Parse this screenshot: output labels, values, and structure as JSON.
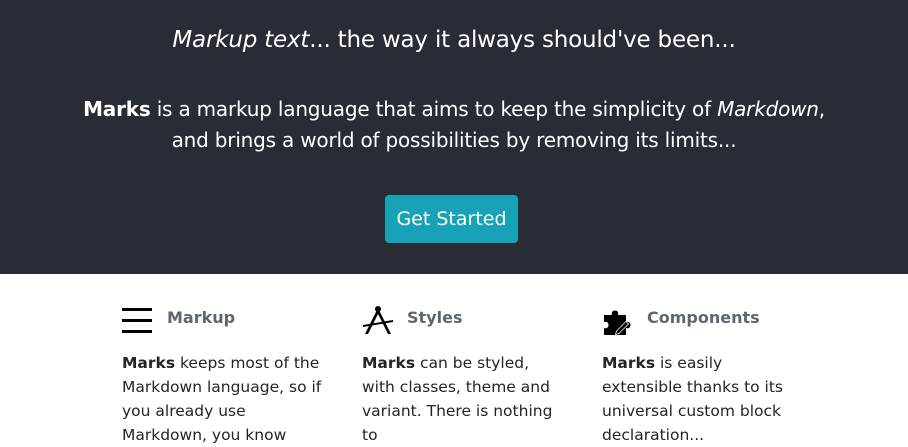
{
  "hero": {
    "tagline_em": "Markup text",
    "tagline_rest": "... the way it always should've been...",
    "intro_brand": "Marks",
    "intro_part1": " is a markup language that aims to keep the simplicity of ",
    "intro_em": "Markdown",
    "intro_part2": ",",
    "intro_line2": "and brings a world of possibilities by removing its limits...",
    "cta_label": "Get Started"
  },
  "features": [
    {
      "icon": "hamburger-menu-icon",
      "title": "Markup",
      "brand": "Marks",
      "text": " keeps most of the Markdown language, so if you already use Markdown, you know"
    },
    {
      "icon": "drafting-compass-icon",
      "title": "Styles",
      "brand": "Marks",
      "text": " can be styled, with classes, theme and variant. There is nothing to"
    },
    {
      "icon": "puzzle-piece-icon",
      "title": "Components",
      "brand": "Marks",
      "text": " is easily extensible thanks to its universal custom block declaration..."
    }
  ],
  "colors": {
    "hero_bg": "#282c34",
    "cta_bg": "#17a2b8",
    "feature_title": "#5f6670"
  }
}
